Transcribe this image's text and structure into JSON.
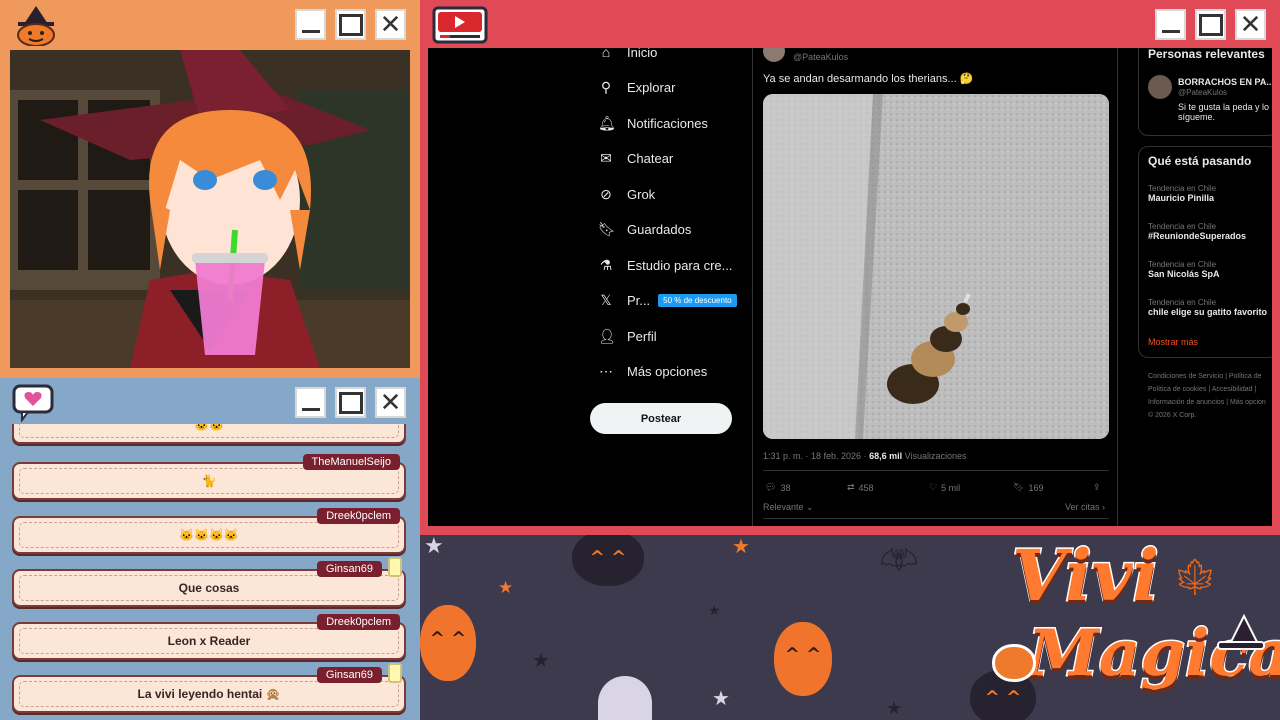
{
  "windows": {
    "cam": {
      "controls": [
        "minimize",
        "maximize",
        "close"
      ]
    },
    "chat": {
      "controls": [
        "minimize",
        "maximize",
        "close"
      ]
    },
    "youtube": {
      "controls": [
        "minimize",
        "maximize",
        "close"
      ]
    }
  },
  "chat": {
    "messages": [
      {
        "user": "",
        "text": "🐱🐱",
        "has_jar": false
      },
      {
        "user": "TheManuelSeijo",
        "text": "🐈",
        "has_jar": false
      },
      {
        "user": "Dreek0pclem",
        "text": "🐱🐱🐱🐱",
        "has_jar": false
      },
      {
        "user": "Ginsan69",
        "text": "Que cosas",
        "has_jar": true
      },
      {
        "user": "Dreek0pclem",
        "text": "Leon x Reader",
        "has_jar": false
      },
      {
        "user": "Ginsan69",
        "text": "La vivi leyendo hentai 🙊",
        "has_jar": true
      }
    ]
  },
  "twitter": {
    "nav": [
      {
        "icon": "home-icon",
        "glyph": "⌂",
        "label": "Inicio"
      },
      {
        "icon": "search-icon",
        "glyph": "⚲",
        "label": "Explorar"
      },
      {
        "icon": "bell-icon",
        "glyph": "🔔︎",
        "label": "Notificaciones"
      },
      {
        "icon": "mail-icon",
        "glyph": "✉",
        "label": "Chatear"
      },
      {
        "icon": "grok-icon",
        "glyph": "⊘",
        "label": "Grok"
      },
      {
        "icon": "bookmark-icon",
        "glyph": "🔖︎",
        "label": "Guardados"
      },
      {
        "icon": "studio-icon",
        "glyph": "⚗",
        "label": "Estudio para cre..."
      },
      {
        "icon": "x-icon",
        "glyph": "𝕏",
        "label": "Pr..."
      },
      {
        "icon": "profile-icon",
        "glyph": "👤︎",
        "label": "Perfil"
      },
      {
        "icon": "more-icon",
        "glyph": "⋯",
        "label": "Más opciones"
      }
    ],
    "premium_badge": "50 % de descuento",
    "post_button": "Postear",
    "tweet": {
      "handle": "@PateaKulos",
      "text": "Ya se andan desarmando los therians... 🤔",
      "timestamp": "1:31 p. m. · 18 feb. 2026 ·",
      "views_count": "68,6 mil",
      "views_label": "Visualizaciones",
      "replies": "38",
      "retweets": "458",
      "likes": "5 mil",
      "bookmarks": "169",
      "relevant_sort": "Relevante",
      "view_quotes": "Ver citas"
    },
    "sidebar": {
      "relevant_title": "Personas relevantes",
      "person_name": "BORRACHOS EN PA...",
      "person_handle": "@PateaKulos",
      "person_bio_1": "Si te gusta la peda y lo",
      "person_bio_2": "sígueme.",
      "trends_title": "Qué está pasando",
      "trends": [
        {
          "context": "Tendencia en Chile",
          "name": "Mauricio Pinilla"
        },
        {
          "context": "Tendencia en Chile",
          "name": "#ReuniondeSuperados"
        },
        {
          "context": "Tendencia en Chile",
          "name": "San Nicolás SpA"
        },
        {
          "context": "Tendencia en Chile",
          "name": "chile elige su gatito favorito"
        }
      ],
      "show_more": "Mostrar más",
      "footer": [
        "Condiciones de Servicio",
        "|",
        "Política de",
        "Política de cookies",
        "|",
        "Accesibilidad",
        "|",
        "Información de anuncios",
        "|",
        "Más opcion",
        "© 2026 X Corp."
      ]
    }
  },
  "branding": {
    "logo_line1": "Vivi",
    "logo_line2": "Magica"
  },
  "colors": {
    "cam_frame": "#ef9a5c",
    "chat_frame": "#85a7c8",
    "youtube_frame": "#e04a57",
    "background": "#3e3a4e",
    "accent_orange": "#f0742c",
    "twitter_blue": "#1d9bf0",
    "mostrar_mas": "#f4511e"
  }
}
